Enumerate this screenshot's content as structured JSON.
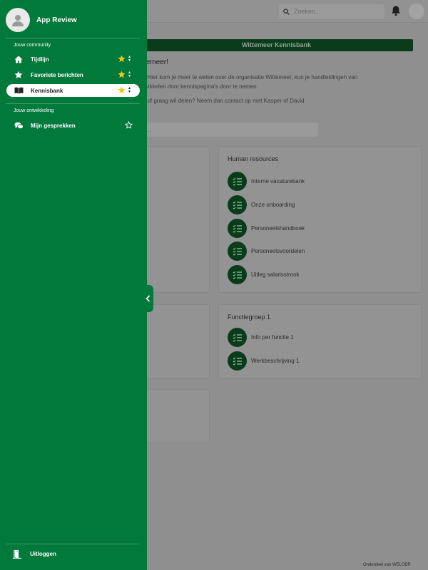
{
  "header": {
    "search_placeholder": "Zoeken..."
  },
  "page": {
    "banner_title": "Wittemeer Kennisbank",
    "welcome": "temeer!",
    "intro_line1": ". Hier kom je meer te weten over de organisatie Wittemeer, kun je handleidingen van",
    "intro_line2": "wikkelen door kennispagina's door te nemen.",
    "contact_line": "t of graag wil delen? Neem dan contact op met Kasper of David",
    "search_placeholder": "..."
  },
  "cards": {
    "human_resources": {
      "title": "Human resources",
      "items": [
        "Interne vacaturebank",
        "Onze onboarding",
        "Personeelshandboek",
        "Personeelsvoordelen",
        "Uitleg salarisstrook"
      ]
    },
    "functiegroep": {
      "title": "Functiegroep 1",
      "items": [
        "Info per functie 1",
        "Werkbeschrijving 1"
      ]
    }
  },
  "drawer": {
    "username": "App Review",
    "section_community": "Jouw community",
    "section_development": "Jouw ontwikkeling",
    "items": [
      {
        "label": "Tijdlijn",
        "icon": "home-icon",
        "favorite": true
      },
      {
        "label": "Favoriete berichten",
        "icon": "star-icon",
        "favorite": true
      },
      {
        "label": "Kennisbank",
        "icon": "book-icon",
        "favorite": true,
        "active": true
      },
      {
        "label": "Mijn gesprekken",
        "icon": "chat-icon",
        "favorite": false
      }
    ],
    "logout_label": "Uitloggen"
  },
  "footer": {
    "note": "Onderdeel van WELDER"
  },
  "colors": {
    "drawer_bg": "#00793a",
    "accent_dark_green": "#0a3c1c",
    "favorite_star": "#f5c518"
  }
}
